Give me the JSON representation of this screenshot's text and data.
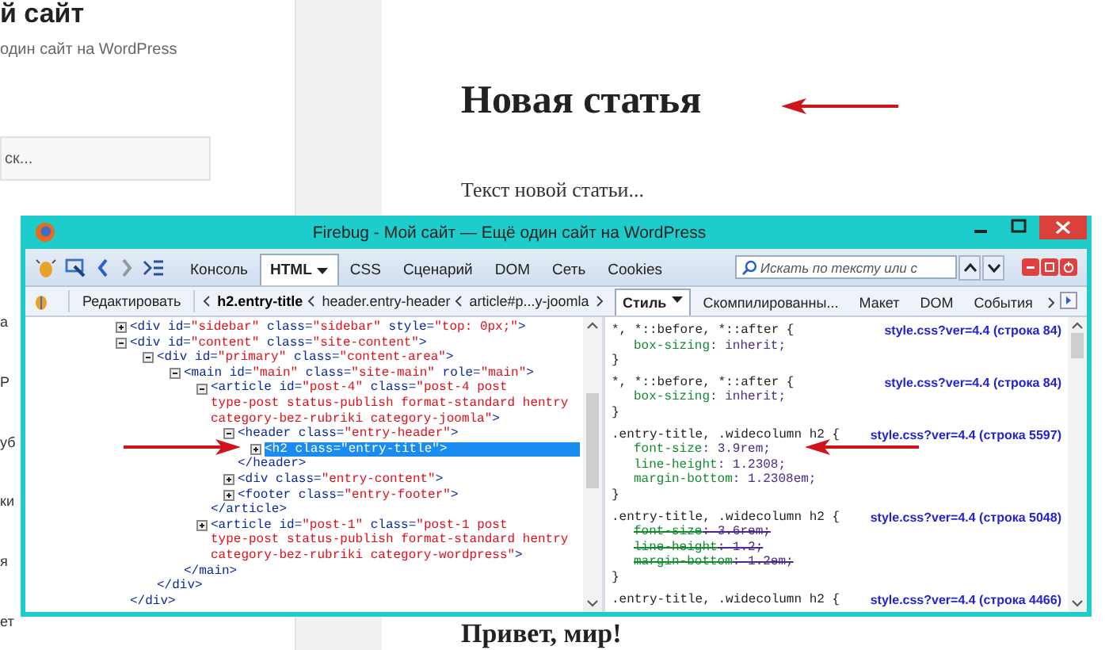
{
  "page": {
    "site_title": "й сайт",
    "site_description": "один сайт на WordPress",
    "search": {
      "placeholder": "ск..."
    },
    "sidebar_fragments": [
      "a",
      "Р",
      "уб",
      "ки",
      "я",
      "ет"
    ],
    "post_title": "Новая статья",
    "post_text": "Текст новой статьи...",
    "next_post_title": "Привет, мир!"
  },
  "firebug": {
    "title": "Firebug - Мой сайт — Ещё один сайт на WordPress",
    "tabs": [
      {
        "label": "Консоль",
        "selected": false,
        "dropdown": false
      },
      {
        "label": "HTML",
        "selected": true,
        "dropdown": true
      },
      {
        "label": "CSS",
        "selected": false,
        "dropdown": false
      },
      {
        "label": "Сценарий",
        "selected": false,
        "dropdown": false
      },
      {
        "label": "DOM",
        "selected": false,
        "dropdown": false
      },
      {
        "label": "Сеть",
        "selected": false,
        "dropdown": false
      },
      {
        "label": "Cookies",
        "selected": false,
        "dropdown": false
      }
    ],
    "search": {
      "placeholder": "Искать по тексту или с"
    },
    "edit_button": "Редактировать",
    "breadcrumbs": [
      {
        "label": "h2.entry-title",
        "selected": true
      },
      {
        "label": "header.entry-header",
        "selected": false
      },
      {
        "label": "article#p...y-joomla",
        "selected": false
      }
    ],
    "side_tabs": [
      {
        "label": "Стиль",
        "selected": true,
        "dropdown": true
      },
      {
        "label": "Скомпилированны...",
        "selected": false,
        "dropdown": false
      },
      {
        "label": "Макет",
        "selected": false,
        "dropdown": false
      },
      {
        "label": "DOM",
        "selected": false,
        "dropdown": false
      },
      {
        "label": "События",
        "selected": false,
        "dropdown": false
      }
    ],
    "html_tree": [
      {
        "text": "<div id=\"sidebar\" class=\"sidebar\" style=\"top: 0px;\">",
        "expanded": false,
        "selected": false
      },
      {
        "text": "<div id=\"content\" class=\"site-content\">",
        "expanded": true,
        "selected": false,
        "children": [
          {
            "text": "<div id=\"primary\" class=\"content-area\">",
            "expanded": true,
            "selected": false,
            "children": [
              {
                "text": "<main id=\"main\" class=\"site-main\" role=\"main\">",
                "expanded": true,
                "selected": false,
                "children": [
                  {
                    "text": "<article id=\"post-4\" class=\"post-4 post type-post status-publish format-standard hentry category-bez-rubriki category-joomla\">",
                    "expanded": true,
                    "selected": false,
                    "children": [
                      {
                        "text": "<header class=\"entry-header\">",
                        "expanded": true,
                        "selected": false,
                        "children": [
                          {
                            "text": "<h2 class=\"entry-title\">",
                            "expanded": false,
                            "selected": true
                          }
                        ]
                      },
                      {
                        "text": "</header>",
                        "selected": false
                      },
                      {
                        "text": "<div class=\"entry-content\">",
                        "expanded": false,
                        "selected": false
                      },
                      {
                        "text": "<footer class=\"entry-footer\">",
                        "expanded": false,
                        "selected": false
                      }
                    ]
                  },
                  {
                    "text": "</article>",
                    "selected": false
                  },
                  {
                    "text": "<article id=\"post-1\" class=\"post-1 post type-post status-publish format-standard hentry category-bez-rubriki category-wordpress\">",
                    "expanded": false,
                    "selected": false
                  }
                ]
              },
              {
                "text": "</main>",
                "selected": false
              }
            ]
          },
          {
            "text": "</div>",
            "selected": false
          }
        ]
      },
      {
        "text": "</div>",
        "selected": false
      }
    ],
    "css_rules": [
      {
        "selector": "*, *::before, *::after {",
        "source": "style.css?ver=4.4 (строка 84)",
        "declarations": [
          {
            "text": "box-sizing: inherit;",
            "overridden": false
          }
        ],
        "close": "}"
      },
      {
        "selector": "*, *::before, *::after {",
        "source": "style.css?ver=4.4 (строка 84)",
        "declarations": [
          {
            "text": "box-sizing: inherit;",
            "overridden": false
          }
        ],
        "close": "}"
      },
      {
        "selector": ".entry-title, .widecolumn h2 {",
        "source": "style.css?ver=4.4 (строка 5597)",
        "declarations": [
          {
            "text": "font-size: 3.9rem;",
            "overridden": false
          },
          {
            "text": "line-height: 1.2308;",
            "overridden": false
          },
          {
            "text": "margin-bottom: 1.2308em;",
            "overridden": false
          }
        ],
        "close": "}"
      },
      {
        "selector": ".entry-title, .widecolumn h2 {",
        "source": "style.css?ver=4.4 (строка 5048)",
        "declarations": [
          {
            "text": "font-size: 3.6rem;",
            "overridden": true
          },
          {
            "text": "line-height: 1.2;",
            "overridden": true
          },
          {
            "text": "margin-bottom: 1.2em;",
            "overridden": true
          }
        ],
        "close": "}"
      },
      {
        "selector": ".entry-title, .widecolumn h2 {",
        "source": "style.css?ver=4.4 (строка 4466)"
      }
    ]
  }
}
